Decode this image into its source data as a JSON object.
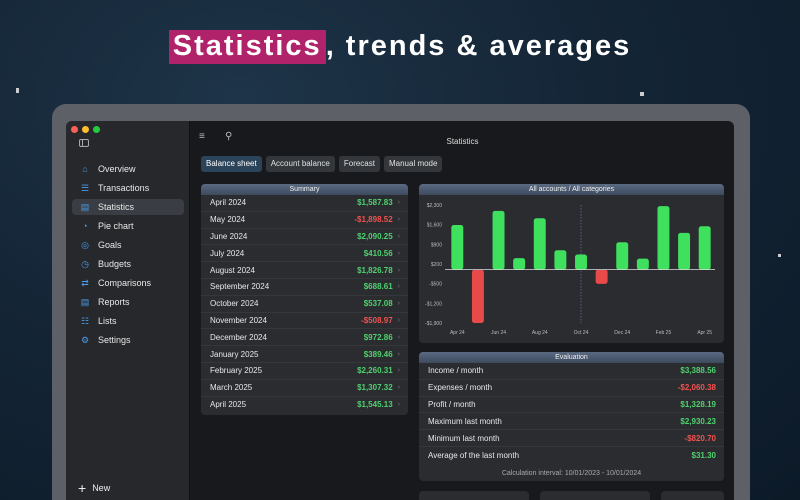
{
  "headline": {
    "highlight": "Statistics",
    "rest": ", trends & averages"
  },
  "colors": {
    "accent_highlight": "#b0236a",
    "positive": "#4fd16e",
    "negative": "#ef5350",
    "bar_positive": "#3ee05e",
    "bar_negative": "#e84a4a"
  },
  "window": {
    "title": "Statistics"
  },
  "sidebar": {
    "items": [
      {
        "label": "Overview",
        "icon": "home-icon"
      },
      {
        "label": "Transactions",
        "icon": "list-icon"
      },
      {
        "label": "Statistics",
        "icon": "bar-chart-icon",
        "active": true
      },
      {
        "label": "Pie chart",
        "icon": "pie-chart-icon"
      },
      {
        "label": "Goals",
        "icon": "target-icon"
      },
      {
        "label": "Budgets",
        "icon": "gauge-icon"
      },
      {
        "label": "Comparisons",
        "icon": "compare-icon"
      },
      {
        "label": "Reports",
        "icon": "document-icon"
      },
      {
        "label": "Lists",
        "icon": "lists-icon"
      },
      {
        "label": "Settings",
        "icon": "gear-icon"
      }
    ],
    "new_label": "New"
  },
  "tabs": [
    {
      "label": "Balance sheet",
      "active": true
    },
    {
      "label": "Account balance"
    },
    {
      "label": "Forecast"
    },
    {
      "label": "Manual mode"
    }
  ],
  "summary": {
    "title": "Summary",
    "rows": [
      {
        "month": "April 2024",
        "value": "$1,587.83",
        "positive": true
      },
      {
        "month": "May 2024",
        "value": "-$1,898.52",
        "positive": false
      },
      {
        "month": "June 2024",
        "value": "$2,090.25",
        "positive": true
      },
      {
        "month": "July 2024",
        "value": "$410.56",
        "positive": true
      },
      {
        "month": "August 2024",
        "value": "$1,826.78",
        "positive": true
      },
      {
        "month": "September 2024",
        "value": "$688.61",
        "positive": true
      },
      {
        "month": "October 2024",
        "value": "$537.08",
        "positive": true
      },
      {
        "month": "November 2024",
        "value": "-$508.97",
        "positive": false
      },
      {
        "month": "December 2024",
        "value": "$972.86",
        "positive": true
      },
      {
        "month": "January 2025",
        "value": "$389.46",
        "positive": true
      },
      {
        "month": "February 2025",
        "value": "$2,260.31",
        "positive": true
      },
      {
        "month": "March 2025",
        "value": "$1,307.32",
        "positive": true
      },
      {
        "month": "April 2025",
        "value": "$1,545.13",
        "positive": true
      }
    ]
  },
  "chart_panel": {
    "title": "All accounts / All categories"
  },
  "chart_data": {
    "type": "bar",
    "title": "All accounts / All categories",
    "categories": [
      "Apr 24",
      "May 24",
      "Jun 24",
      "Jul 24",
      "Aug 24",
      "Sep 24",
      "Oct 24",
      "Nov 24",
      "Dec 24",
      "Jan 25",
      "Feb 25",
      "Mar 25",
      "Apr 25"
    ],
    "values": [
      1587.83,
      -1898.52,
      2090.25,
      410.56,
      1826.78,
      688.61,
      537.08,
      -508.97,
      972.86,
      389.46,
      2260.31,
      1307.32,
      1545.13
    ],
    "y_ticks": [
      "$2,300",
      "$1,600",
      "$900",
      "$200",
      "-$500",
      "-$1,200",
      "-$1,900"
    ],
    "x_ticks": [
      "Apr 24",
      "Jun 24",
      "Aug 24",
      "Oct 24",
      "Dec 24",
      "Feb 25",
      "Apr 25"
    ],
    "ylim": [
      -1900,
      2300
    ],
    "grid": false
  },
  "evaluation": {
    "title": "Evaluation",
    "rows": [
      {
        "label": "Income / month",
        "value": "$3,388.56",
        "positive": true
      },
      {
        "label": "Expenses / month",
        "value": "-$2,060.38",
        "positive": false
      },
      {
        "label": "Profit / month",
        "value": "$1,328.19",
        "positive": true
      },
      {
        "label": "Maximum last month",
        "value": "$2,930.23",
        "positive": true
      },
      {
        "label": "Minimum last month",
        "value": "-$820.70",
        "positive": false
      },
      {
        "label": "Average of the last month",
        "value": "$31.30",
        "positive": true
      }
    ],
    "footer": "Calculation interval: 10/01/2023 - 10/01/2024"
  }
}
